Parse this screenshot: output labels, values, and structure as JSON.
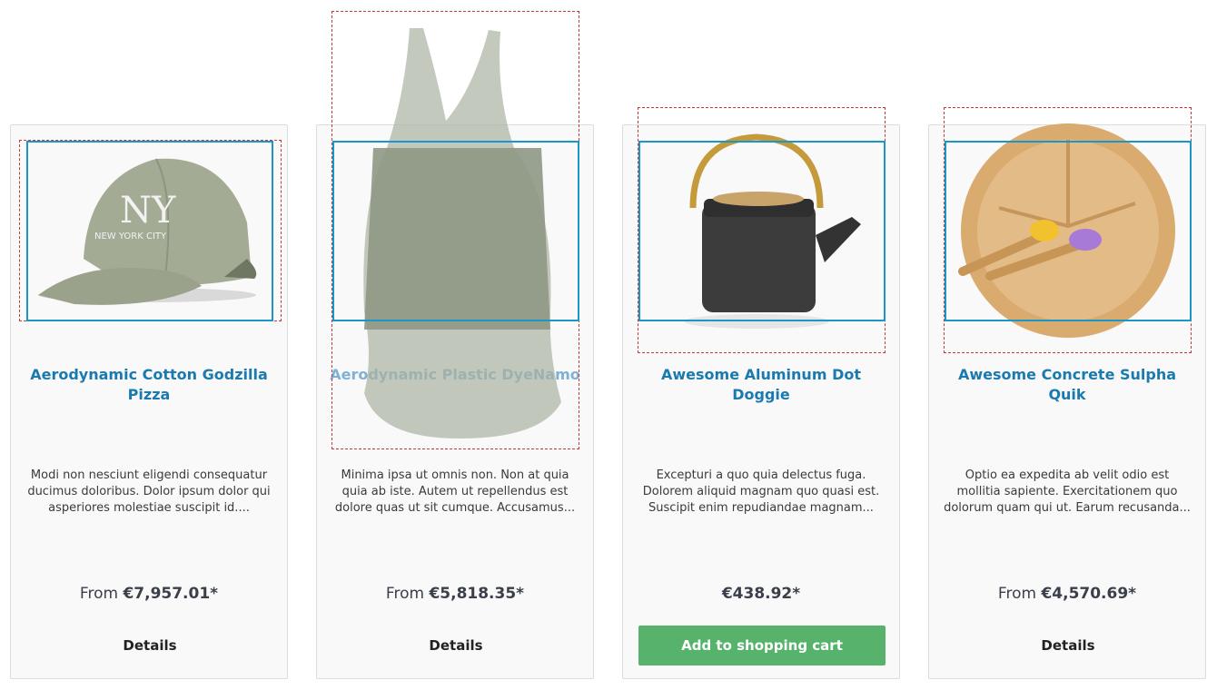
{
  "products": [
    {
      "title": "Aerodynamic Cotton Godzilla Pizza",
      "description": "Modi non nesciunt eligendi consequatur ducimus doloribus. Dolor ipsum dolor qui asperiores molestiae suscipit id....",
      "price_prefix": "From ",
      "price": "€7,957.01*",
      "action_label": "Details",
      "image_text_main": "NY",
      "image_text_sub": "NEW YORK CITY"
    },
    {
      "title": "Aerodynamic Plastic DyeNamo",
      "description": "Minima ipsa ut omnis non. Non at quia quia ab iste. Autem ut repellendus est dolore quas ut sit cumque. Accusamus...",
      "price_prefix": "From ",
      "price": "€5,818.35*",
      "action_label": "Details"
    },
    {
      "title": "Awesome Aluminum Dot Doggie",
      "description": "Excepturi a quo quia delectus fuga. Dolorem aliquid magnam quo quasi est. Suscipit enim repudiandae magnam...",
      "price_prefix": "",
      "price": "€438.92*",
      "action_label": "Add to shopping cart"
    },
    {
      "title": "Awesome Concrete Sulpha Quik",
      "description": "Optio ea expedita ab velit odio est mollitia sapiente. Exercitationem quo dolorum quam qui ut. Earum recusanda...",
      "price_prefix": "From ",
      "price": "€4,570.69*",
      "action_label": "Details"
    }
  ],
  "colors": {
    "title": "#1a7ab0",
    "cart_button": "#57b36b",
    "image_box_border": "#1a96c8",
    "debug_outline": "#c43a3a"
  }
}
